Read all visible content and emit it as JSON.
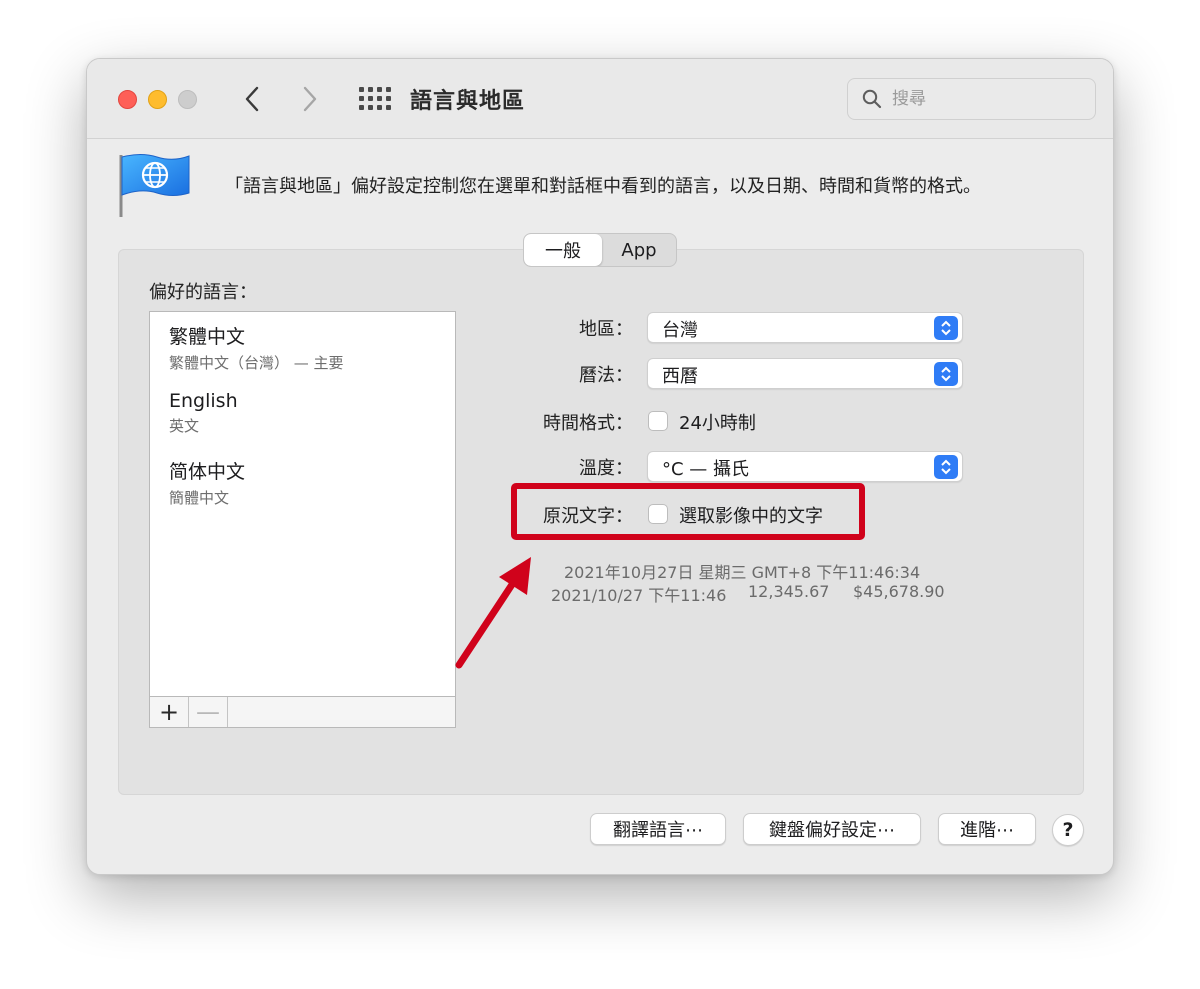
{
  "window": {
    "title": "語言與地區",
    "search_placeholder": "搜尋",
    "description": "「語言與地區」偏好設定控制您在選單和對話框中看到的語言，以及日期、時間和貨幣的格式。"
  },
  "tabs": [
    {
      "label": "一般",
      "selected": true
    },
    {
      "label": "App",
      "selected": false
    }
  ],
  "preferred_languages": {
    "label": "偏好的語言：",
    "items": [
      {
        "name": "繁體中文",
        "sub": "繁體中文（台灣） — 主要"
      },
      {
        "name": "English",
        "sub": "英文"
      },
      {
        "name": "简体中文",
        "sub": "簡體中文"
      }
    ],
    "add_label": "+",
    "remove_label": "—"
  },
  "settings": {
    "region": {
      "label": "地區：",
      "value": "台灣"
    },
    "calendar": {
      "label": "曆法：",
      "value": "西曆"
    },
    "time_format": {
      "label": "時間格式：",
      "checkbox_label": "24小時制",
      "checked": false
    },
    "temperature": {
      "label": "溫度：",
      "value": "°C — 攝氏"
    },
    "live_text": {
      "label": "原況文字：",
      "checkbox_label": "選取影像中的文字",
      "checked": false
    }
  },
  "sample": {
    "line1": "2021年10月27日 星期三 GMT+8 下午11:46:34",
    "line2_date": "2021/10/27 下午11:46",
    "line2_number": "12,345.67",
    "line2_currency": "$45,678.90"
  },
  "buttons": {
    "translation": "翻譯語言⋯",
    "keyboard": "鍵盤偏好設定⋯",
    "advanced": "進階⋯",
    "help": "?"
  },
  "colors": {
    "accent": "#2f7cf6",
    "annotation": "#d0021b",
    "close": "#fe5f57",
    "minimize": "#febc2e"
  }
}
